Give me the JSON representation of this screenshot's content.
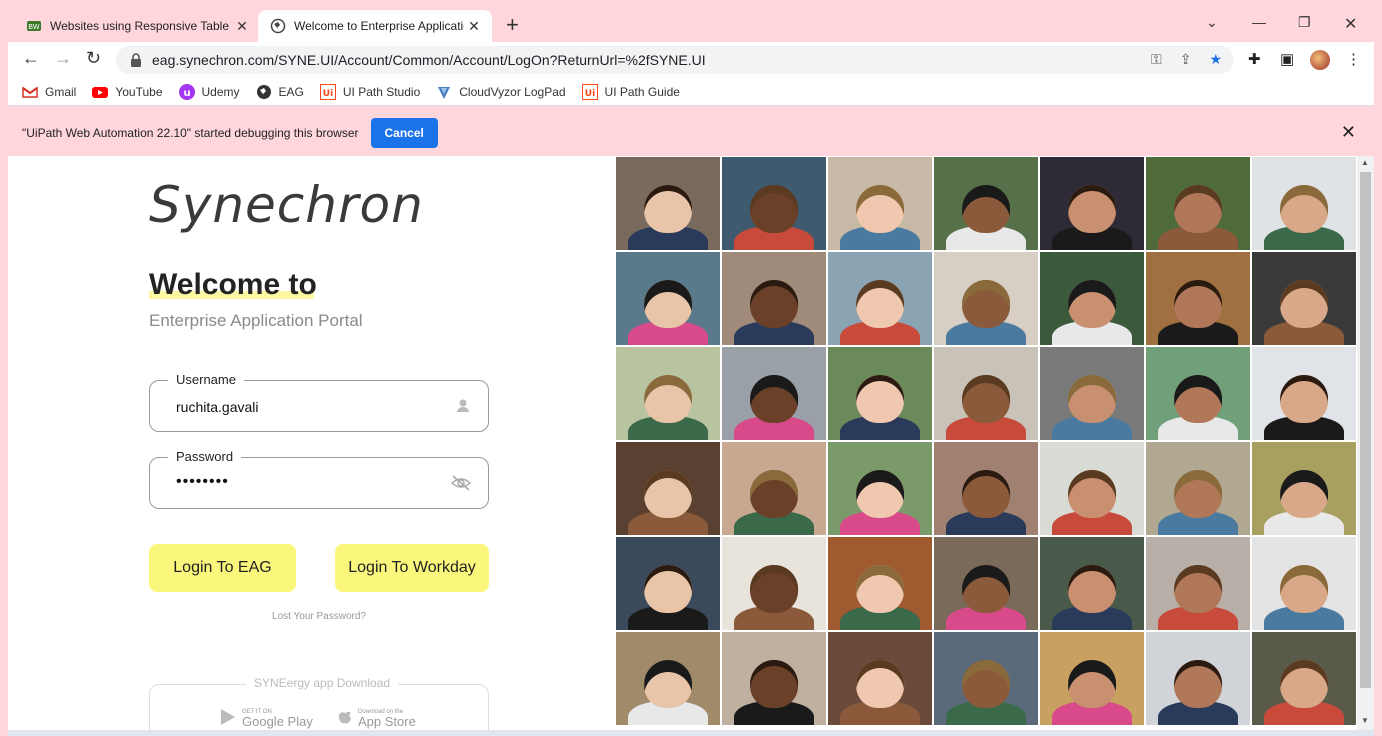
{
  "browser": {
    "tabs": [
      {
        "title": "Websites using Responsive Table",
        "favicon": "builtwith-icon"
      },
      {
        "title": "Welcome to Enterprise Applicatio",
        "favicon": "globe-icon"
      }
    ],
    "url": "eag.synechron.com/SYNE.UI/Account/Common/Account/LogOn?ReturnUrl=%2fSYNE.UI",
    "bookmarks": [
      {
        "label": "Gmail",
        "icon": "gmail-icon"
      },
      {
        "label": "YouTube",
        "icon": "youtube-icon"
      },
      {
        "label": "Udemy",
        "icon": "udemy-icon"
      },
      {
        "label": "EAG",
        "icon": "globe-icon"
      },
      {
        "label": "UI Path Studio",
        "icon": "uipath-icon"
      },
      {
        "label": "CloudVyzor LogPad",
        "icon": "cloudvyzor-icon"
      },
      {
        "label": "UI Path Guide",
        "icon": "uipath-icon"
      }
    ],
    "infobar": {
      "message": "\"UiPath Web Automation 22.10\" started debugging this browser",
      "cancel_label": "Cancel"
    }
  },
  "login": {
    "logo": "Synechron",
    "welcome": "Welcome to",
    "subtitle": "Enterprise Application Portal",
    "username_label": "Username",
    "username_value": "ruchita.gavali",
    "password_label": "Password",
    "password_value": "••••••••",
    "login_eag_label": "Login To EAG",
    "login_workday_label": "Login To Workday",
    "lost_password_label": "Lost Your Password?",
    "download_label": "SYNEergy app Download",
    "google_play_label": "Google Play",
    "google_play_small": "GET IT ON",
    "app_store_label": "App Store",
    "app_store_small": "Download on the"
  },
  "colors": {
    "accent_button": "#fbf77c",
    "chrome_pink": "#ffd6dc",
    "cancel_blue": "#1a73e8"
  }
}
